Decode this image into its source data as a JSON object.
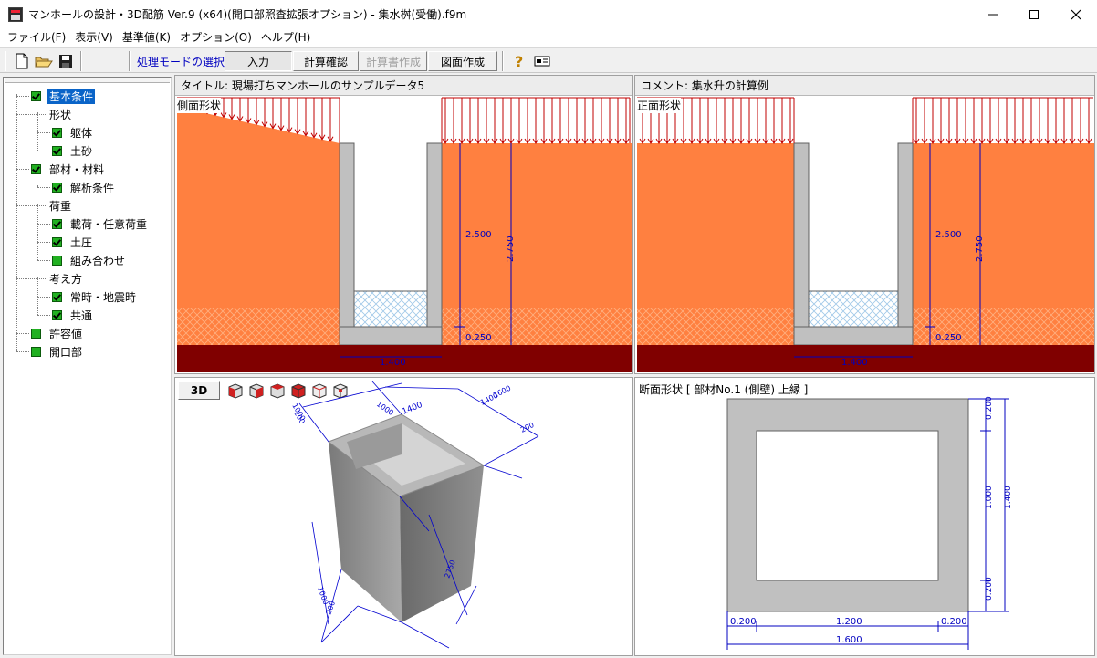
{
  "window": {
    "title": "マンホールの設計・3D配筋 Ver.9 (x64)(開口部照査拡張オプション) - 集水桝(受働).f9m"
  },
  "menu": [
    "ファイル(F)",
    "表示(V)",
    "基準値(K)",
    "オプション(O)",
    "ヘルプ(H)"
  ],
  "toolbar": {
    "mode_label": "処理モードの選択",
    "buttons": {
      "input": "入力",
      "calc_check": "計算確認",
      "report": "計算書作成",
      "drawing": "図面作成"
    },
    "icons": [
      "new-file-icon",
      "open-folder-icon",
      "save-disk-icon",
      "help-icon",
      "version-info-icon"
    ]
  },
  "tree": [
    {
      "label": "基本条件",
      "checkbox": true,
      "checked": true,
      "selected": true
    },
    {
      "label": "形状",
      "checkbox": false
    },
    {
      "label": "躯体",
      "checkbox": true,
      "checked": true
    },
    {
      "label": "土砂",
      "checkbox": true,
      "checked": true
    },
    {
      "label": "部材・材料",
      "checkbox": true,
      "checked": true
    },
    {
      "label": "解析条件",
      "checkbox": true,
      "checked": true
    },
    {
      "label": "荷重",
      "checkbox": false
    },
    {
      "label": "載荷・任意荷重",
      "checkbox": true,
      "checked": true
    },
    {
      "label": "土圧",
      "checkbox": true,
      "checked": true
    },
    {
      "label": "組み合わせ",
      "checkbox": true,
      "checked": false
    },
    {
      "label": "考え方",
      "checkbox": false
    },
    {
      "label": "常時・地震時",
      "checkbox": true,
      "checked": true
    },
    {
      "label": "共通",
      "checkbox": true,
      "checked": true
    },
    {
      "label": "許容値",
      "checkbox": true,
      "checked": false
    },
    {
      "label": "開口部",
      "checkbox": true,
      "checked": false
    }
  ],
  "panels": {
    "side_view": {
      "header": "タイトル: 現場打ちマンホールのサンプルデータ5",
      "label": "側面形状",
      "dims": {
        "h1": "2.500",
        "h2": "2.750",
        "h3": "0.250",
        "width": "1.400"
      }
    },
    "front_view": {
      "header": "コメント: 集水升の計算例",
      "label": "正面形状",
      "dims": {
        "h1": "2.500",
        "h2": "2.750",
        "h3": "0.250",
        "width": "1.400"
      }
    },
    "view3d": {
      "button": "3D",
      "dims": [
        "1400",
        "1000",
        "1400",
        "1600",
        "200",
        "1000",
        "200",
        "1000",
        "2750",
        "200"
      ]
    },
    "section": {
      "label": "断面形状 [ 部材No.1 (側壁) 上縁 ]",
      "dims": {
        "top": "0.200",
        "middle": "1.000",
        "bottom": "0.200",
        "total": "1.400",
        "left": "0.200",
        "center": "1.200",
        "right": "0.200",
        "width_total": "1.600"
      }
    }
  },
  "colors": {
    "soil": "#ff8040",
    "concrete": "#c0c0c0",
    "base": "#800000",
    "dimension": "#0000c0",
    "load": "#c00000",
    "selection": "#0a64c8"
  }
}
